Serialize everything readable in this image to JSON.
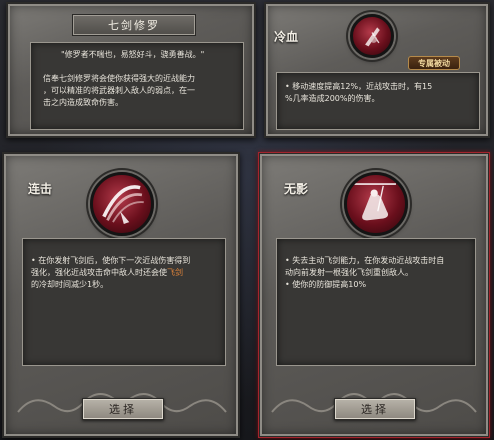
{
  "top_card": {
    "name": "七剑修罗",
    "quote": "\"修罗者不喘也，易怒好斗，骁勇善战。\"",
    "desc_line1": "信奉七剑修罗将会使你获得强大的近战能力",
    "desc_line2": "，可以精准的将武器刺入敌人的弱点，在一",
    "desc_line3": "击之内造成致命伤害。"
  },
  "passive_card": {
    "label": "冷血",
    "tag": "专属被动",
    "desc_line1": "• 移动速度提高12%，近战攻击时，有15",
    "desc_line2": "%几率造成200%的伤害。"
  },
  "option_left": {
    "label": "连击",
    "desc_line1": "• 在你发射飞剑后，使你下一次近战伤害得到",
    "desc_line2": "强化，强化近战攻击命中敌人时还会使",
    "desc_highlight": "飞剑",
    "desc_line3": "的冷却时间减少1秒。",
    "select_label": "选择",
    "icon": "slash-combo-icon"
  },
  "option_right": {
    "label": "无影",
    "desc_line1": "• 失去主动飞剑能力，在你发动近战攻击时自",
    "desc_line2": "动向前发射一根强化飞剑重创敌人。",
    "desc_line3": "• 使你的防御提高10%",
    "select_label": "选择",
    "icon": "crouching-swordsman-icon"
  },
  "colors": {
    "stone": "#5e5c59",
    "panel": "#383735",
    "accent_red": "#a4242c",
    "highlight": "#e0843a"
  }
}
